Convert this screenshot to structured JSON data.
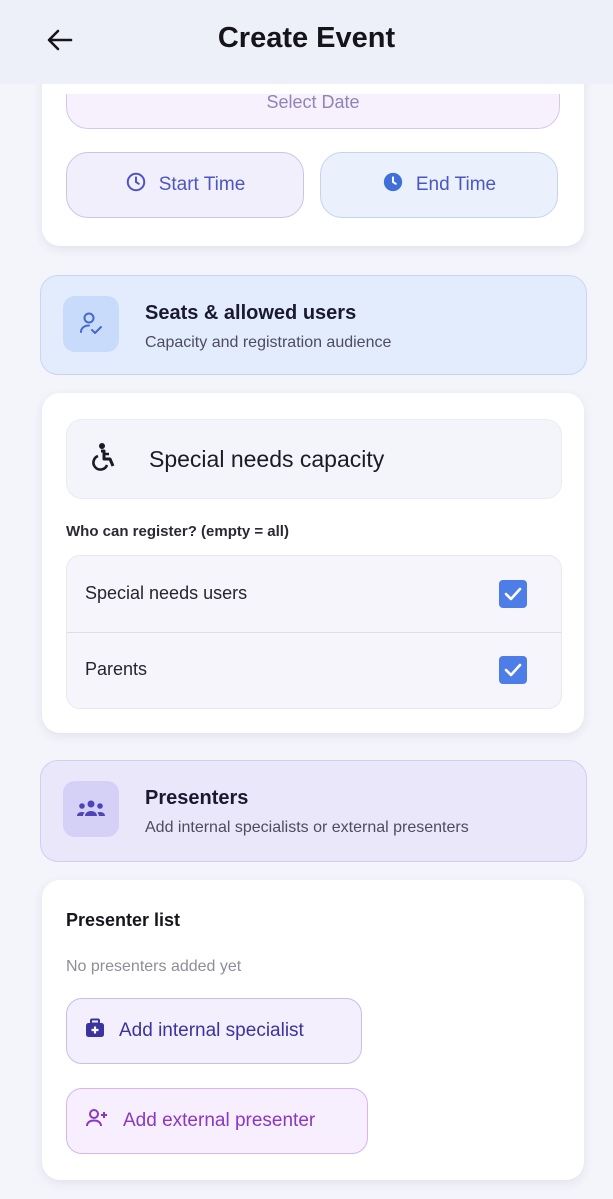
{
  "header": {
    "title": "Create Event",
    "back_icon": "arrow-left-icon"
  },
  "schedule": {
    "date_label": "Select Date",
    "start_time_label": "Start Time",
    "end_time_label": "End Time"
  },
  "seats_section": {
    "title": "Seats & allowed users",
    "subtitle": "Capacity and registration audience",
    "icon": "user-check-icon"
  },
  "seats_card": {
    "special_needs_label": "Special needs capacity",
    "who_can_register_label": "Who can register? (empty = all)",
    "options": [
      {
        "label": "Special needs users",
        "checked": true
      },
      {
        "label": "Parents",
        "checked": true
      }
    ]
  },
  "presenters_section": {
    "title": "Presenters",
    "subtitle": "Add internal specialists or external presenters",
    "icon": "group-icon"
  },
  "presenter_list": {
    "title": "Presenter list",
    "empty_text": "No presenters added yet",
    "add_internal_label": "Add internal specialist",
    "add_external_label": "Add external presenter"
  },
  "colors": {
    "primary": "#4b56c2",
    "checkbox": "#4d7de6",
    "external_accent": "#8a37c4"
  }
}
